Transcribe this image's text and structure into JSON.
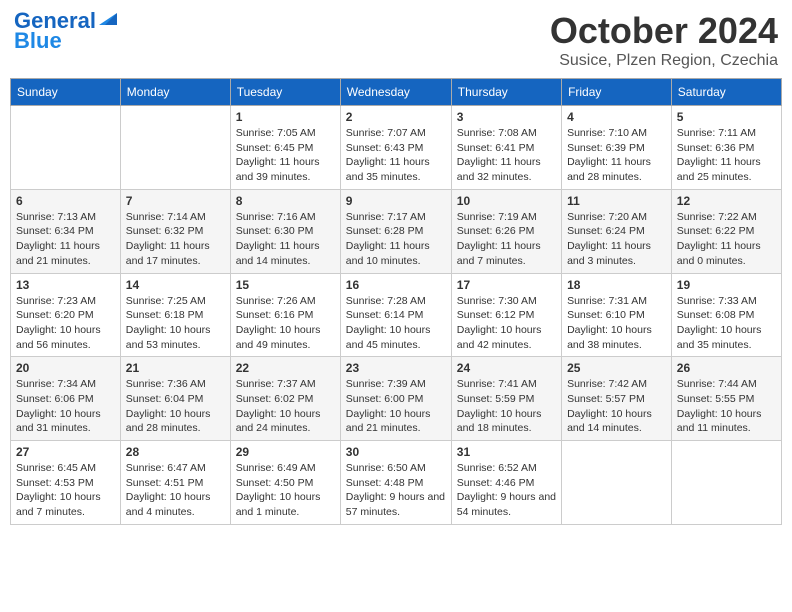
{
  "logo": {
    "line1": "General",
    "line2": "Blue"
  },
  "title": "October 2024",
  "location": "Susice, Plzen Region, Czechia",
  "weekdays": [
    "Sunday",
    "Monday",
    "Tuesday",
    "Wednesday",
    "Thursday",
    "Friday",
    "Saturday"
  ],
  "weeks": [
    [
      {
        "day": "",
        "info": ""
      },
      {
        "day": "",
        "info": ""
      },
      {
        "day": "1",
        "sunrise": "7:05 AM",
        "sunset": "6:45 PM",
        "daylight": "11 hours and 39 minutes."
      },
      {
        "day": "2",
        "sunrise": "7:07 AM",
        "sunset": "6:43 PM",
        "daylight": "11 hours and 35 minutes."
      },
      {
        "day": "3",
        "sunrise": "7:08 AM",
        "sunset": "6:41 PM",
        "daylight": "11 hours and 32 minutes."
      },
      {
        "day": "4",
        "sunrise": "7:10 AM",
        "sunset": "6:39 PM",
        "daylight": "11 hours and 28 minutes."
      },
      {
        "day": "5",
        "sunrise": "7:11 AM",
        "sunset": "6:36 PM",
        "daylight": "11 hours and 25 minutes."
      }
    ],
    [
      {
        "day": "6",
        "sunrise": "7:13 AM",
        "sunset": "6:34 PM",
        "daylight": "11 hours and 21 minutes."
      },
      {
        "day": "7",
        "sunrise": "7:14 AM",
        "sunset": "6:32 PM",
        "daylight": "11 hours and 17 minutes."
      },
      {
        "day": "8",
        "sunrise": "7:16 AM",
        "sunset": "6:30 PM",
        "daylight": "11 hours and 14 minutes."
      },
      {
        "day": "9",
        "sunrise": "7:17 AM",
        "sunset": "6:28 PM",
        "daylight": "11 hours and 10 minutes."
      },
      {
        "day": "10",
        "sunrise": "7:19 AM",
        "sunset": "6:26 PM",
        "daylight": "11 hours and 7 minutes."
      },
      {
        "day": "11",
        "sunrise": "7:20 AM",
        "sunset": "6:24 PM",
        "daylight": "11 hours and 3 minutes."
      },
      {
        "day": "12",
        "sunrise": "7:22 AM",
        "sunset": "6:22 PM",
        "daylight": "11 hours and 0 minutes."
      }
    ],
    [
      {
        "day": "13",
        "sunrise": "7:23 AM",
        "sunset": "6:20 PM",
        "daylight": "10 hours and 56 minutes."
      },
      {
        "day": "14",
        "sunrise": "7:25 AM",
        "sunset": "6:18 PM",
        "daylight": "10 hours and 53 minutes."
      },
      {
        "day": "15",
        "sunrise": "7:26 AM",
        "sunset": "6:16 PM",
        "daylight": "10 hours and 49 minutes."
      },
      {
        "day": "16",
        "sunrise": "7:28 AM",
        "sunset": "6:14 PM",
        "daylight": "10 hours and 45 minutes."
      },
      {
        "day": "17",
        "sunrise": "7:30 AM",
        "sunset": "6:12 PM",
        "daylight": "10 hours and 42 minutes."
      },
      {
        "day": "18",
        "sunrise": "7:31 AM",
        "sunset": "6:10 PM",
        "daylight": "10 hours and 38 minutes."
      },
      {
        "day": "19",
        "sunrise": "7:33 AM",
        "sunset": "6:08 PM",
        "daylight": "10 hours and 35 minutes."
      }
    ],
    [
      {
        "day": "20",
        "sunrise": "7:34 AM",
        "sunset": "6:06 PM",
        "daylight": "10 hours and 31 minutes."
      },
      {
        "day": "21",
        "sunrise": "7:36 AM",
        "sunset": "6:04 PM",
        "daylight": "10 hours and 28 minutes."
      },
      {
        "day": "22",
        "sunrise": "7:37 AM",
        "sunset": "6:02 PM",
        "daylight": "10 hours and 24 minutes."
      },
      {
        "day": "23",
        "sunrise": "7:39 AM",
        "sunset": "6:00 PM",
        "daylight": "10 hours and 21 minutes."
      },
      {
        "day": "24",
        "sunrise": "7:41 AM",
        "sunset": "5:59 PM",
        "daylight": "10 hours and 18 minutes."
      },
      {
        "day": "25",
        "sunrise": "7:42 AM",
        "sunset": "5:57 PM",
        "daylight": "10 hours and 14 minutes."
      },
      {
        "day": "26",
        "sunrise": "7:44 AM",
        "sunset": "5:55 PM",
        "daylight": "10 hours and 11 minutes."
      }
    ],
    [
      {
        "day": "27",
        "sunrise": "6:45 AM",
        "sunset": "4:53 PM",
        "daylight": "10 hours and 7 minutes."
      },
      {
        "day": "28",
        "sunrise": "6:47 AM",
        "sunset": "4:51 PM",
        "daylight": "10 hours and 4 minutes."
      },
      {
        "day": "29",
        "sunrise": "6:49 AM",
        "sunset": "4:50 PM",
        "daylight": "10 hours and 1 minute."
      },
      {
        "day": "30",
        "sunrise": "6:50 AM",
        "sunset": "4:48 PM",
        "daylight": "9 hours and 57 minutes."
      },
      {
        "day": "31",
        "sunrise": "6:52 AM",
        "sunset": "4:46 PM",
        "daylight": "9 hours and 54 minutes."
      },
      {
        "day": "",
        "info": ""
      },
      {
        "day": "",
        "info": ""
      }
    ]
  ],
  "labels": {
    "sunrise": "Sunrise:",
    "sunset": "Sunset:",
    "daylight": "Daylight:"
  }
}
